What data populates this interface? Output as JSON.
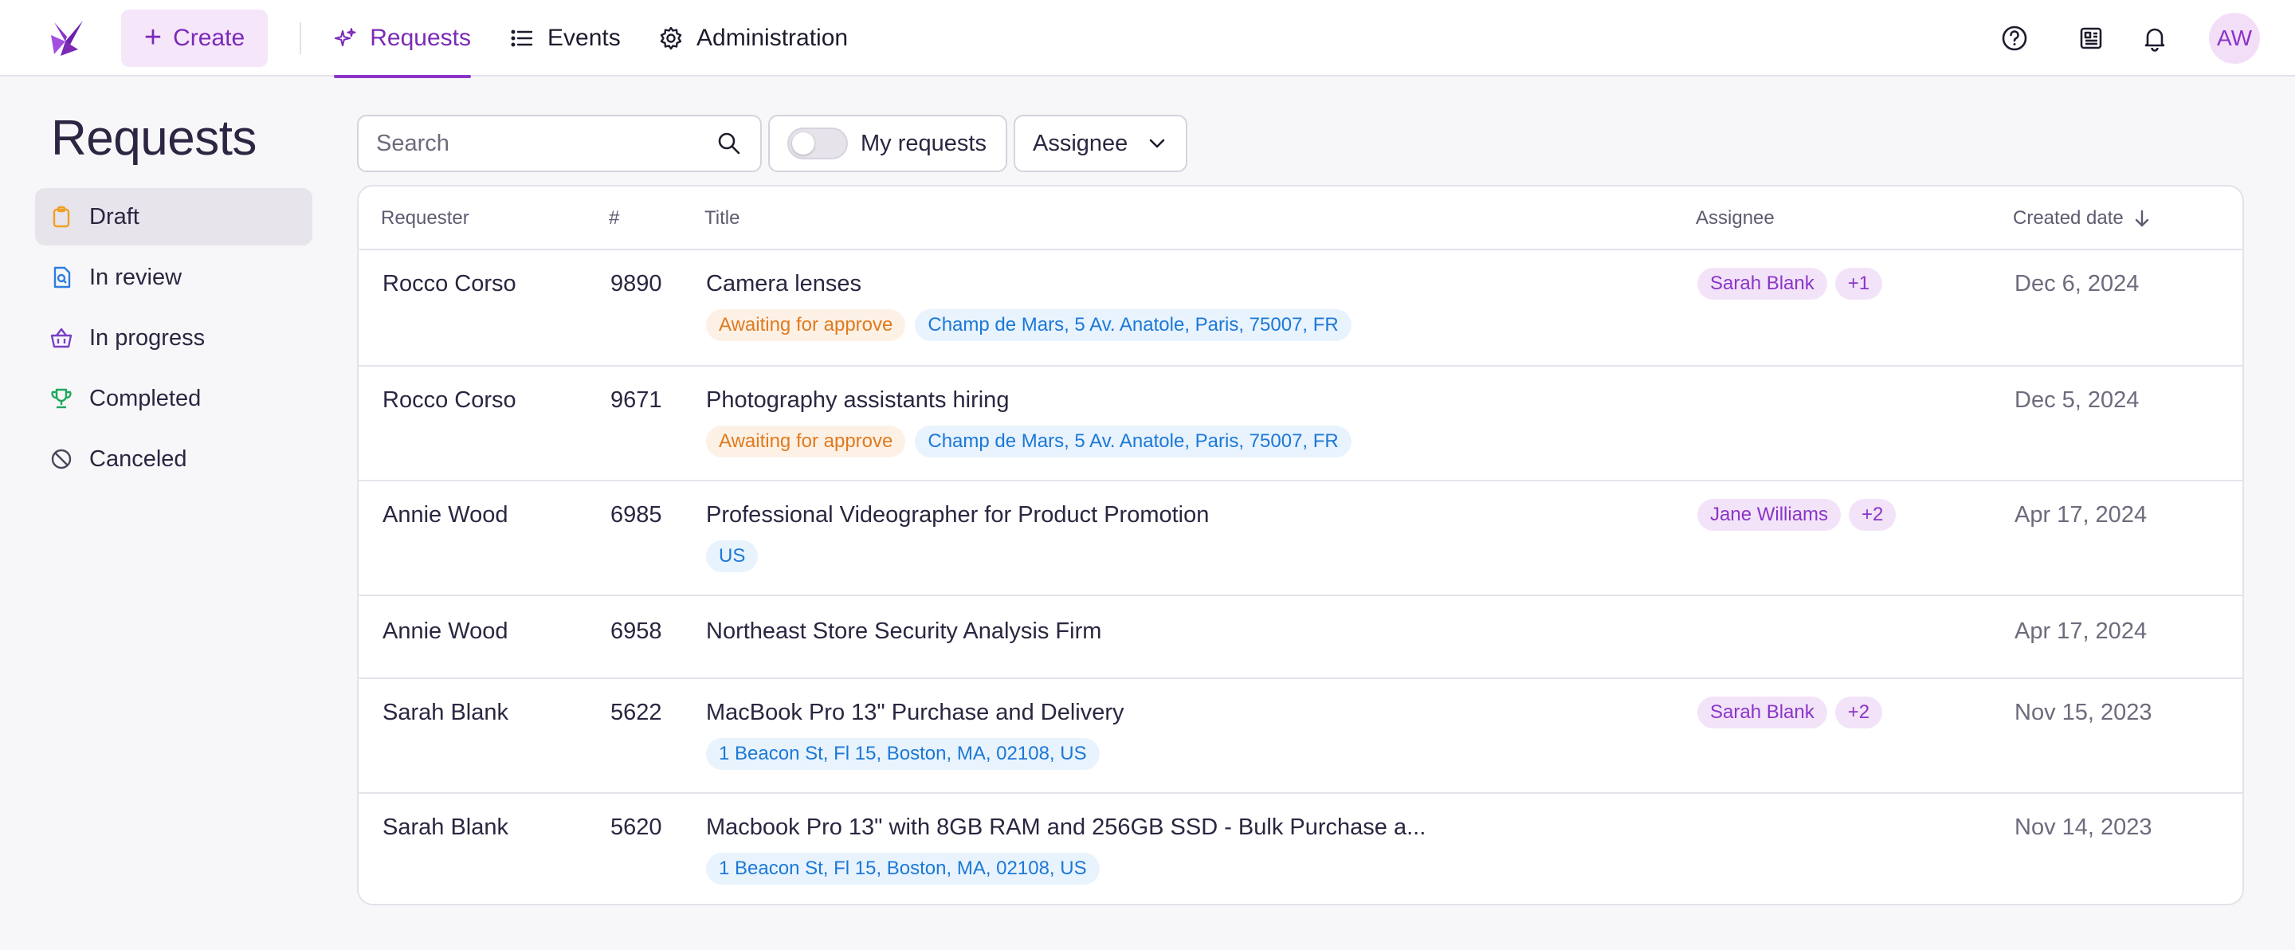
{
  "nav": {
    "create_label": "Create",
    "tabs": [
      {
        "label": "Requests",
        "icon": "sparkles-icon",
        "active": true
      },
      {
        "label": "Events",
        "icon": "list-icon",
        "active": false
      },
      {
        "label": "Administration",
        "icon": "gear-icon",
        "active": false
      }
    ],
    "right_icons": [
      "help-icon",
      "news-icon",
      "bell-icon"
    ],
    "avatar_initials": "AW"
  },
  "page_title": "Requests",
  "sidebar": {
    "items": [
      {
        "label": "Draft",
        "icon": "clipboard-icon",
        "active": true,
        "color": "#f0a020"
      },
      {
        "label": "In review",
        "icon": "document-search-icon",
        "active": false,
        "color": "#2d7de0"
      },
      {
        "label": "In progress",
        "icon": "basket-icon",
        "active": false,
        "color": "#7a3fc8"
      },
      {
        "label": "Completed",
        "icon": "trophy-icon",
        "active": false,
        "color": "#1ea85a"
      },
      {
        "label": "Canceled",
        "icon": "ban-icon",
        "active": false,
        "color": "#4a4658"
      }
    ]
  },
  "filters": {
    "search_placeholder": "Search",
    "my_requests_label": "My requests",
    "my_requests_on": false,
    "assignee_label": "Assignee"
  },
  "table": {
    "columns": {
      "requester": "Requester",
      "number": "#",
      "title": "Title",
      "assignee": "Assignee",
      "created": "Created date"
    },
    "rows": [
      {
        "requester": "Rocco Corso",
        "number": "9890",
        "title": "Camera lenses",
        "status": "Awaiting for approve",
        "location": "Champ de Mars, 5 Av. Anatole, Paris, 75007, FR",
        "assignee": "Sarah Blank",
        "assignee_more": "+1",
        "date": "Dec 6, 2024"
      },
      {
        "requester": "Rocco Corso",
        "number": "9671",
        "title": "Photography assistants hiring",
        "status": "Awaiting for approve",
        "location": "Champ de Mars, 5 Av. Anatole, Paris, 75007, FR",
        "assignee": "",
        "assignee_more": "",
        "date": "Dec 5, 2024"
      },
      {
        "requester": "Annie Wood",
        "number": "6985",
        "title": "Professional Videographer for Product Promotion",
        "status": "",
        "location": "US",
        "assignee": "Jane Williams",
        "assignee_more": "+2",
        "date": "Apr 17, 2024"
      },
      {
        "requester": "Annie Wood",
        "number": "6958",
        "title": "Northeast Store Security Analysis Firm",
        "status": "",
        "location": "",
        "assignee": "",
        "assignee_more": "",
        "date": "Apr 17, 2024"
      },
      {
        "requester": "Sarah Blank",
        "number": "5622",
        "title": "MacBook Pro 13\" Purchase and Delivery",
        "status": "",
        "location": "1 Beacon St, Fl 15, Boston, MA, 02108, US",
        "assignee": "Sarah Blank",
        "assignee_more": "+2",
        "date": "Nov 15, 2023"
      },
      {
        "requester": "Sarah Blank",
        "number": "5620",
        "title": "Macbook Pro 13\" with 8GB RAM and 256GB SSD - Bulk Purchase a...",
        "status": "",
        "location": "1 Beacon St, Fl 15, Boston, MA, 02108, US",
        "assignee": "",
        "assignee_more": "",
        "date": "Nov 14, 2023"
      }
    ]
  },
  "colors": {
    "brand": "#8a35c7",
    "status_orange": "#e07a1f",
    "location_blue": "#1c78d6"
  }
}
